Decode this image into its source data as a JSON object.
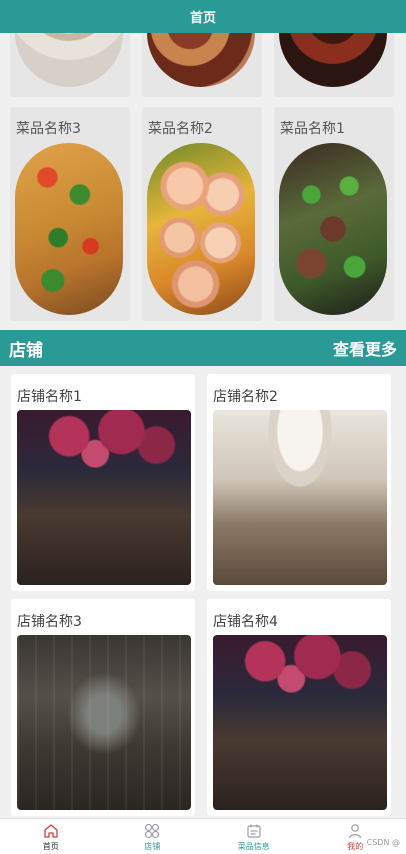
{
  "header": {
    "title": "首页"
  },
  "dishes": {
    "row_full": [
      {
        "name": "菜品名称3"
      },
      {
        "name": "菜品名称2"
      },
      {
        "name": "菜品名称1"
      }
    ]
  },
  "shop": {
    "title": "店铺",
    "more": "查看更多",
    "items": [
      {
        "name": "店铺名称1"
      },
      {
        "name": "店铺名称2"
      },
      {
        "name": "店铺名称3"
      },
      {
        "name": "店铺名称4"
      }
    ]
  },
  "tabs": [
    {
      "label": "首页",
      "icon": "home-icon"
    },
    {
      "label": "店铺",
      "icon": "shop-grid-icon"
    },
    {
      "label": "菜品信息",
      "icon": "dish-info-icon"
    },
    {
      "label": "我的",
      "icon": "user-icon"
    }
  ],
  "watermark": "CSDN @",
  "colors": {
    "accent": "#2a9a96",
    "mine_label": "#d23b3b"
  }
}
